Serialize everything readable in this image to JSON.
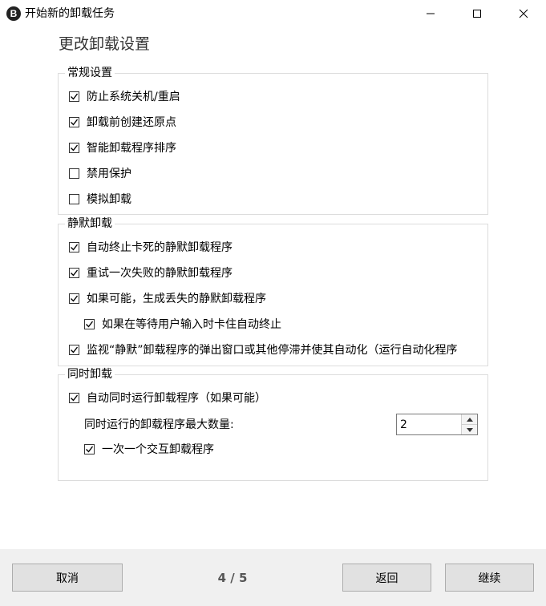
{
  "window": {
    "title": "开始新的卸载任务",
    "app_icon_glyph": "B",
    "controls": [
      "minimize-icon",
      "maximize-icon",
      "close-icon"
    ]
  },
  "page_heading": "更改卸载设置",
  "groups": {
    "general": {
      "title": "常规设置",
      "options": [
        {
          "label": "防止系统关机/重启",
          "checked": true
        },
        {
          "label": "卸载前创建还原点",
          "checked": true
        },
        {
          "label": "智能卸载程序排序",
          "checked": true
        },
        {
          "label": "禁用保护",
          "checked": false
        },
        {
          "label": "模拟卸载",
          "checked": false
        }
      ]
    },
    "quiet": {
      "title": "静默卸载",
      "options": [
        {
          "label": "自动终止卡死的静默卸载程序",
          "checked": true
        },
        {
          "label": "重试一次失败的静默卸载程序",
          "checked": true
        },
        {
          "label": "如果可能，生成丢失的静默卸载程序",
          "checked": true
        },
        {
          "label": "如果在等待用户输入时卡住自动终止",
          "checked": true
        },
        {
          "label": "监视“静默”卸载程序的弹出窗口或其他停滞并使其自动化（运行自动化程序",
          "checked": true
        }
      ]
    },
    "concurrent": {
      "title": "同时卸载",
      "auto_concurrent": {
        "label": "自动同时运行卸载程序（如果可能）",
        "checked": true
      },
      "max_count_label": "同时运行的卸载程序最大数量:",
      "max_count_value": "2",
      "one_interactive": {
        "label": "一次一个交互卸载程序",
        "checked": true
      }
    }
  },
  "footer": {
    "cancel_label": "取消",
    "page_indicator": "4 / 5",
    "back_label": "返回",
    "next_label": "继续"
  },
  "colors": {
    "footer_bg": "#f0f0f0",
    "button_bg": "#e1e1e1",
    "group_border": "#dcdcdc"
  }
}
